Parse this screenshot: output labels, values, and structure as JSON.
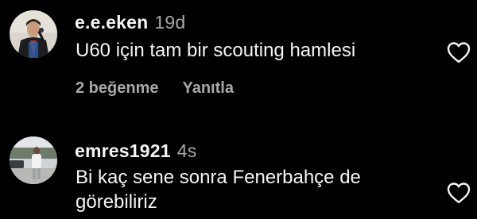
{
  "colors": {
    "background": "#000000",
    "primary_text": "#f5f5f5",
    "secondary_text": "#a8a8a8"
  },
  "comments": [
    {
      "username": "e.e.eken",
      "time": "19d",
      "text_lines": [
        "U60 için tam bir scouting hamlesi"
      ],
      "likes": "2 beğenme",
      "reply": "Yanıtla",
      "avatar_icon": "user-avatar-photo",
      "like_icon": "heart-outline-icon"
    },
    {
      "username": "emres1921",
      "time": "4s",
      "text_lines": [
        "Bi kaç sene sonra Fenerbahçe de",
        "görebiliriz"
      ],
      "avatar_icon": "user-avatar-photo",
      "like_icon": "heart-outline-icon"
    }
  ]
}
